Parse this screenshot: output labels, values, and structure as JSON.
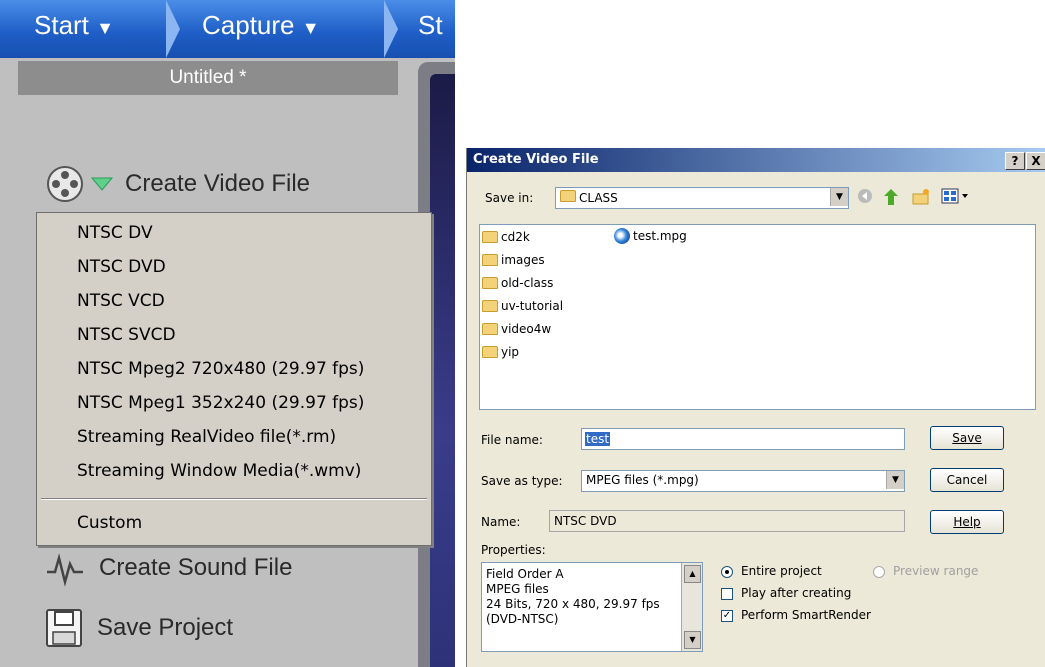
{
  "editor": {
    "steps": [
      "Start",
      "Capture",
      "St"
    ],
    "project_title": "Untitled *",
    "create_video_label": "Create Video File",
    "create_sound_label": "Create Sound File",
    "save_project_label": "Save Project",
    "menu_items": [
      "NTSC DV",
      "NTSC DVD",
      "NTSC VCD",
      "NTSC SVCD",
      "NTSC Mpeg2 720x480 (29.97 fps)",
      "NTSC Mpeg1 352x240 (29.97 fps)",
      "Streaming RealVideo file(*.rm)",
      "Streaming Window Media(*.wmv)"
    ],
    "menu_custom": "Custom"
  },
  "dialog": {
    "title": "Create Video File",
    "help_btn": "?",
    "close_btn": "X",
    "save_in_label": "Save in:",
    "save_in_value": "CLASS",
    "folders": [
      "cd2k",
      "images",
      "old-class",
      "uv-tutorial",
      "video4w",
      "yip"
    ],
    "files": [
      "test.mpg"
    ],
    "file_name_label": "File name:",
    "file_name_value": "test",
    "save_as_type_label": "Save as type:",
    "save_as_type_value": "MPEG files (*.mpg)",
    "name_label": "Name:",
    "name_value": "NTSC DVD",
    "properties_label": "Properties:",
    "properties": [
      "Field Order A",
      "MPEG files",
      "24 Bits, 720 x 480, 29.97 fps",
      "(DVD-NTSC)"
    ],
    "save_button": "Save",
    "cancel_button": "Cancel",
    "help_button": "Help",
    "entire_project": "Entire project",
    "preview_range": "Preview range",
    "play_after": "Play after creating",
    "smart_render": "Perform SmartRender"
  }
}
